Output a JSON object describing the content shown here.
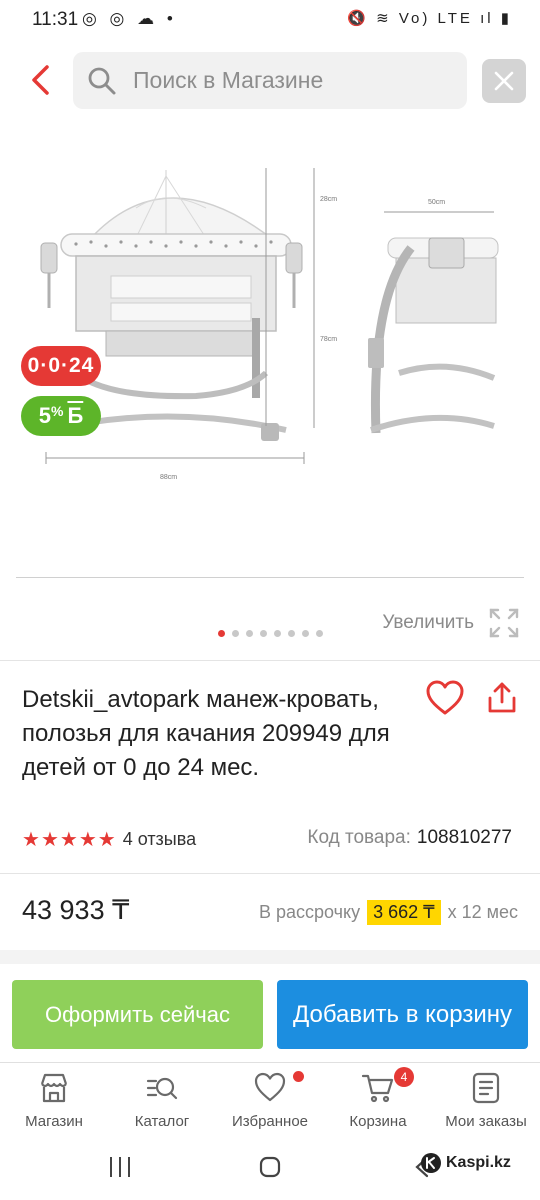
{
  "status_bar": {
    "time": "11:31",
    "left_icons": "◎ ◎ ☁ •",
    "right_icons": "🔇 ≋ Vo) LTE ıl ▮"
  },
  "search": {
    "placeholder": "Поиск в Магазине"
  },
  "product_image": {
    "dimension_labels": [
      "28cm",
      "78cm",
      "88cm",
      "50cm"
    ]
  },
  "badges": {
    "installment": "0·0·24",
    "bonus_percent": "5",
    "bonus_suffix": "%",
    "bonus_currency": "Б"
  },
  "gallery": {
    "zoom_label": "Увеличить",
    "dot_count": 8,
    "active_dot": 0
  },
  "product": {
    "title": "Detskii_avtopark манеж-кровать, полозья для качания 209949 для детей от 0 до 24 мес.",
    "rating_stars": 5,
    "reviews": "4 отзыва",
    "code_label": "Код товара:",
    "code_value": "108810277",
    "price": "43 933 ₸",
    "installment_label": "В рассрочку",
    "installment_amount": "3 662 ₸",
    "installment_term": "х 12 мес"
  },
  "actions": {
    "checkout": "Оформить сейчас",
    "add_to_cart": "Добавить в корзину"
  },
  "bottom_nav": {
    "items": [
      {
        "label": "Магазин",
        "icon": "store-icon"
      },
      {
        "label": "Каталог",
        "icon": "catalog-search-icon"
      },
      {
        "label": "Избранное",
        "icon": "heart-icon"
      },
      {
        "label": "Корзина",
        "icon": "cart-icon"
      },
      {
        "label": "Мои заказы",
        "icon": "orders-icon"
      }
    ],
    "cart_count": "4"
  },
  "watermark": "Kaspi.kz",
  "colors": {
    "brand_red": "#e53935",
    "green": "#5db529",
    "checkout_green": "#8fd05a",
    "cart_blue": "#1c8ee0",
    "installment_yellow": "#ffd600"
  }
}
